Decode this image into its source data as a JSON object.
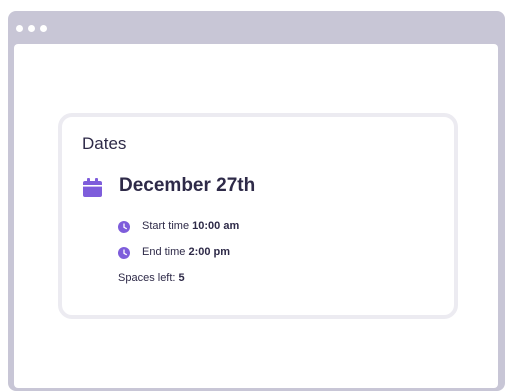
{
  "window": {
    "frame_color": "#c8c6d6"
  },
  "card": {
    "title": "Dates",
    "date": "December 27th",
    "start_label": "Start time",
    "start_value": "10:00 am",
    "end_label": "End time",
    "end_value": "2:00 pm",
    "spaces_label": "Spaces left:",
    "spaces_value": "5"
  },
  "icons": {
    "calendar": "calendar-icon",
    "clock": "clock-icon"
  },
  "colors": {
    "accent": "#7e5ddb",
    "text": "#2e2a48",
    "card_border": "#ecebf1"
  }
}
